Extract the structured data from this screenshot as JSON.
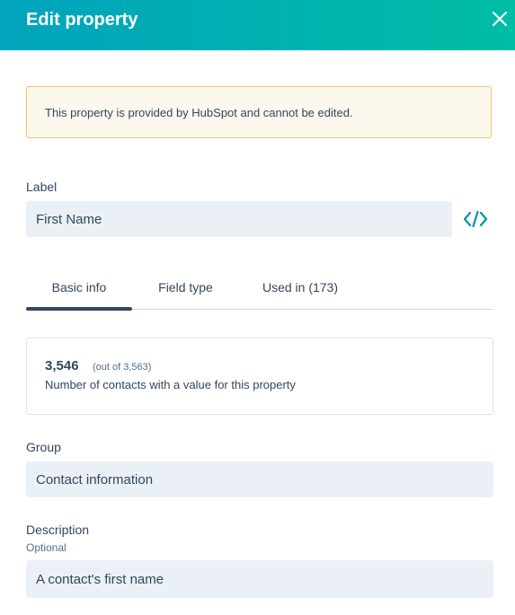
{
  "header": {
    "title": "Edit property",
    "close_icon": "close-icon"
  },
  "notice": {
    "text": "This property is provided by HubSpot and cannot be edited."
  },
  "label_field": {
    "label": "Label",
    "value": "First Name",
    "code_icon": "code-icon"
  },
  "tabs": [
    {
      "label": "Basic info",
      "active": true
    },
    {
      "label": "Field type",
      "active": false
    },
    {
      "label": "Used in (173)",
      "active": false
    }
  ],
  "stats": {
    "count": "3,546",
    "out_of": "(out of 3,563)",
    "description": "Number of contacts with a value for this property"
  },
  "group_field": {
    "label": "Group",
    "value": "Contact information"
  },
  "description_field": {
    "label": "Description",
    "optional": "Optional",
    "value": "A contact's first name"
  },
  "colors": {
    "header_start": "#00a4bd",
    "header_end": "#00bda5",
    "accent": "#0091ae",
    "notice_bg": "#fdf8ee",
    "notice_border": "#f5c26b"
  }
}
